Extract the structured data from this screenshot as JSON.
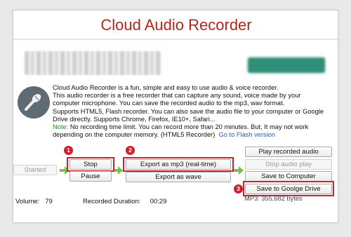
{
  "app": {
    "title": "Cloud Audio Recorder"
  },
  "description": {
    "lines": [
      "Cloud Audio Recorder is a fun, simple and easy to use audio & voice recorder.",
      "This audio recorder is a free recorder that can capture any sound, voice made by your",
      "computer microphone. You can save the recorded audio to the mp3, wav format.",
      "Supports HTML5, Flash recorder. You can also save the audio file to your computer or Google",
      "Drive directly. Supports Chrome, Firefox, IE10+, Safari...",
      " No recording time limit. You can record more than 20 minutes. But, It may not work"
    ],
    "note_label": "Note:",
    "last_line": "depending on the computer memory. (HTML5 Recorder)",
    "flash_link": "Go to Flash version"
  },
  "controls": {
    "started": "Started",
    "stop": "Stop",
    "pause": "Pause",
    "export_mp3": "Export as mp3 (real-time)",
    "export_wave": "Export as wave",
    "play_recorded": "Play recorded audio",
    "stop_audio": "Stop audio play",
    "save_computer": "Save to Computer",
    "save_drive": "Save to Goolge Drive"
  },
  "steps": {
    "one": "1",
    "two": "2",
    "three": "3"
  },
  "status": {
    "volume_label": "Volume:",
    "volume_value": "79",
    "duration_label": "Recorded Duration:",
    "duration_value": "00:29",
    "mp3_size": "MP3: 355,682 bytes"
  },
  "colors": {
    "title": "#b3261e",
    "highlight": "#d0202a",
    "note": "#2f8d2f",
    "link": "#1f5fbf",
    "arrow": "#7cc04b"
  },
  "icons": [
    "microphone-icon",
    "right-arrow-icon"
  ]
}
